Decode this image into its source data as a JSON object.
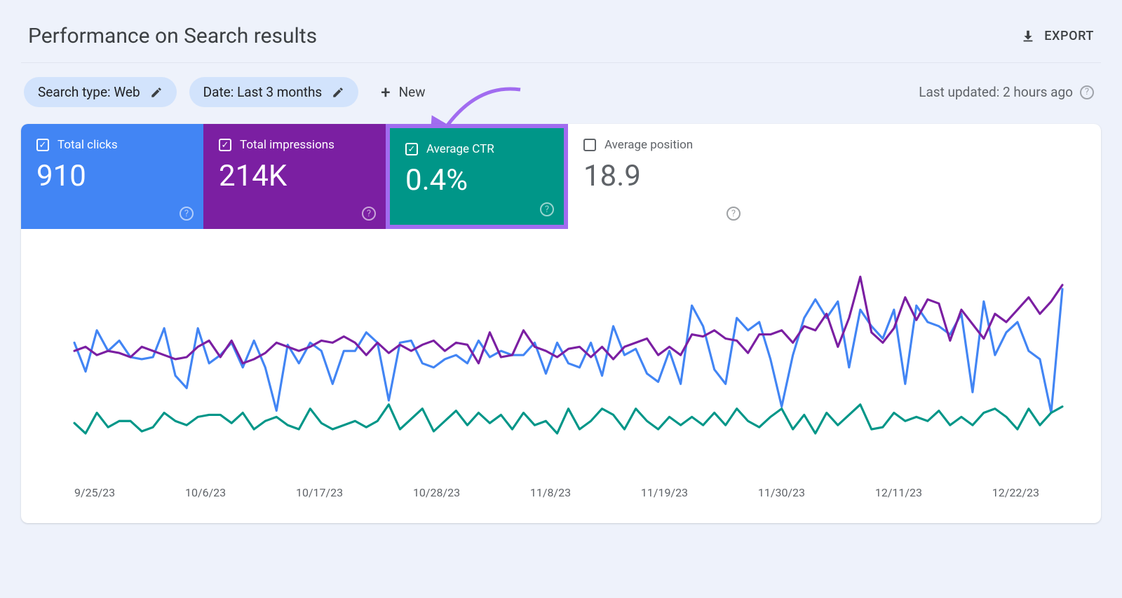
{
  "header": {
    "title": "Performance on Search results",
    "export_label": "EXPORT"
  },
  "filters": {
    "search_type": "Search type: Web",
    "date_range": "Date: Last 3 months",
    "new_label": "New",
    "last_updated": "Last updated: 2 hours ago"
  },
  "tiles": {
    "clicks": {
      "label": "Total clicks",
      "value": "910",
      "checked": true,
      "color": "#4285f4"
    },
    "impressions": {
      "label": "Total impressions",
      "value": "214K",
      "checked": true,
      "color": "#7b1fa2"
    },
    "ctr": {
      "label": "Average CTR",
      "value": "0.4%",
      "checked": true,
      "color": "#009688"
    },
    "position": {
      "label": "Average position",
      "value": "18.9",
      "checked": false,
      "color": "#ffffff"
    }
  },
  "annotation": {
    "target": "ctr-tile",
    "style": "curved-arrow",
    "color": "#a16cf0"
  },
  "chart_data": {
    "type": "line",
    "title": "",
    "xlabel": "",
    "ylabel": "",
    "x_ticks": [
      "9/25/23",
      "10/6/23",
      "10/17/23",
      "10/28/23",
      "11/8/23",
      "11/19/23",
      "11/30/23",
      "12/11/23",
      "12/22/23"
    ],
    "ylim_normalized": [
      0,
      100
    ],
    "note": "y-values normalized 0–100 (axes not labeled in source); three active series (clicks, impressions, CTR)",
    "series": [
      {
        "name": "Total clicks",
        "color": "#4285f4",
        "values": [
          62,
          48,
          68,
          58,
          63,
          55,
          54,
          55,
          69,
          46,
          40,
          69,
          52,
          56,
          62,
          50,
          63,
          50,
          29,
          61,
          52,
          62,
          58,
          42,
          58,
          58,
          67,
          62,
          34,
          62,
          63,
          52,
          50,
          54,
          56,
          52,
          63,
          55,
          58,
          56,
          56,
          62,
          47,
          62,
          52,
          50,
          62,
          46,
          70,
          56,
          59,
          47,
          43,
          58,
          42,
          80,
          70,
          49,
          42,
          74,
          68,
          72,
          54,
          31,
          56,
          74,
          83,
          74,
          82,
          50,
          78,
          70,
          64,
          78,
          42,
          80,
          72,
          70,
          66,
          76,
          38,
          82,
          56,
          67,
          72,
          58,
          54,
          28,
          88
        ]
      },
      {
        "name": "Total impressions",
        "color": "#7b1fa2",
        "values": [
          58,
          60,
          56,
          58,
          57,
          55,
          60,
          58,
          56,
          54,
          55,
          60,
          63,
          55,
          63,
          52,
          54,
          57,
          62,
          60,
          58,
          60,
          63,
          62,
          65,
          62,
          56,
          62,
          57,
          61,
          58,
          61,
          63,
          58,
          62,
          61,
          52,
          67,
          55,
          56,
          68,
          60,
          58,
          55,
          59,
          60,
          55,
          60,
          54,
          60,
          62,
          64,
          56,
          60,
          56,
          66,
          65,
          68,
          64,
          63,
          57,
          66,
          66,
          68,
          62,
          70,
          68,
          76,
          60,
          74,
          94,
          67,
          62,
          69,
          84,
          73,
          83,
          81,
          63,
          78,
          71,
          64,
          76,
          72,
          78,
          84,
          76,
          82,
          90
        ]
      },
      {
        "name": "Average CTR",
        "color": "#009688",
        "values": [
          23,
          18,
          28,
          21,
          24,
          24,
          19,
          21,
          28,
          24,
          22,
          26,
          27,
          27,
          23,
          28,
          20,
          24,
          26,
          22,
          20,
          30,
          23,
          20,
          22,
          24,
          21,
          24,
          32,
          20,
          25,
          30,
          19,
          24,
          29,
          22,
          28,
          23,
          27,
          20,
          28,
          22,
          24,
          18,
          30,
          20,
          24,
          30,
          27,
          20,
          30,
          24,
          20,
          26,
          22,
          26,
          22,
          28,
          22,
          30,
          24,
          21,
          26,
          30,
          20,
          27,
          18,
          28,
          22,
          27,
          32,
          20,
          21,
          28,
          24,
          26,
          24,
          29,
          22,
          26,
          22,
          28,
          30,
          26,
          20,
          30,
          22,
          28,
          31
        ]
      }
    ]
  }
}
